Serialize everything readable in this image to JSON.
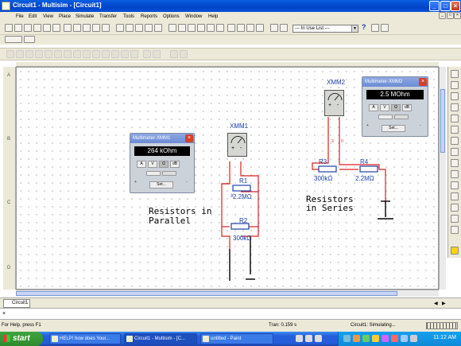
{
  "window": {
    "title": "Circuit1 - Multisim - [Circuit1]"
  },
  "menu": [
    "File",
    "Edit",
    "View",
    "Place",
    "Simulate",
    "Transfer",
    "Tools",
    "Reports",
    "Options",
    "Window",
    "Help"
  ],
  "toolbar": {
    "in_use_list": "--- In Use List ---"
  },
  "ruler": {
    "rows": [
      "A",
      "B",
      "C",
      "D"
    ]
  },
  "canvas": {
    "label_parallel": [
      "Resistors in",
      "Parallel"
    ],
    "label_series": [
      "Resistors",
      "in Series"
    ],
    "xmm1_label": "XMM1",
    "xmm2_label": "XMM2",
    "components": {
      "R1": {
        "name": "R1",
        "value": "2.2MΩ"
      },
      "R2": {
        "name": "R2",
        "value": "300kΩ"
      },
      "R3": {
        "name": "R3",
        "value": "300kΩ"
      },
      "R4": {
        "name": "R4",
        "value": "2.2MΩ"
      }
    },
    "xmm2_pins": [
      "3",
      "0"
    ],
    "r1_pin": "X"
  },
  "multimeter1": {
    "title": "Multimeter-XMM1",
    "reading": "264 kOhm",
    "buttons": [
      "A",
      "V",
      "Ω",
      "dB"
    ],
    "set_label": "Set...",
    "jacks": [
      "+",
      "-"
    ]
  },
  "multimeter2": {
    "title": "Multimeter-XMM2",
    "reading": "2.5 MOhm",
    "buttons": [
      "A",
      "V",
      "Ω",
      "dB"
    ],
    "set_label": "Set...",
    "jacks": [
      "+",
      "-"
    ]
  },
  "tabs": {
    "circuit_tab": "Circuit1"
  },
  "status": {
    "help": "For Help, press F1",
    "tran": "Tran: 0.159 s",
    "sim": "Circuit1: Simulating..."
  },
  "taskbar": {
    "start": "start",
    "tasks": [
      "HELP! how does Your...",
      "Circuit1 - Multisim - [C...",
      "untitled - Paint"
    ],
    "clock": "11:12 AM"
  }
}
